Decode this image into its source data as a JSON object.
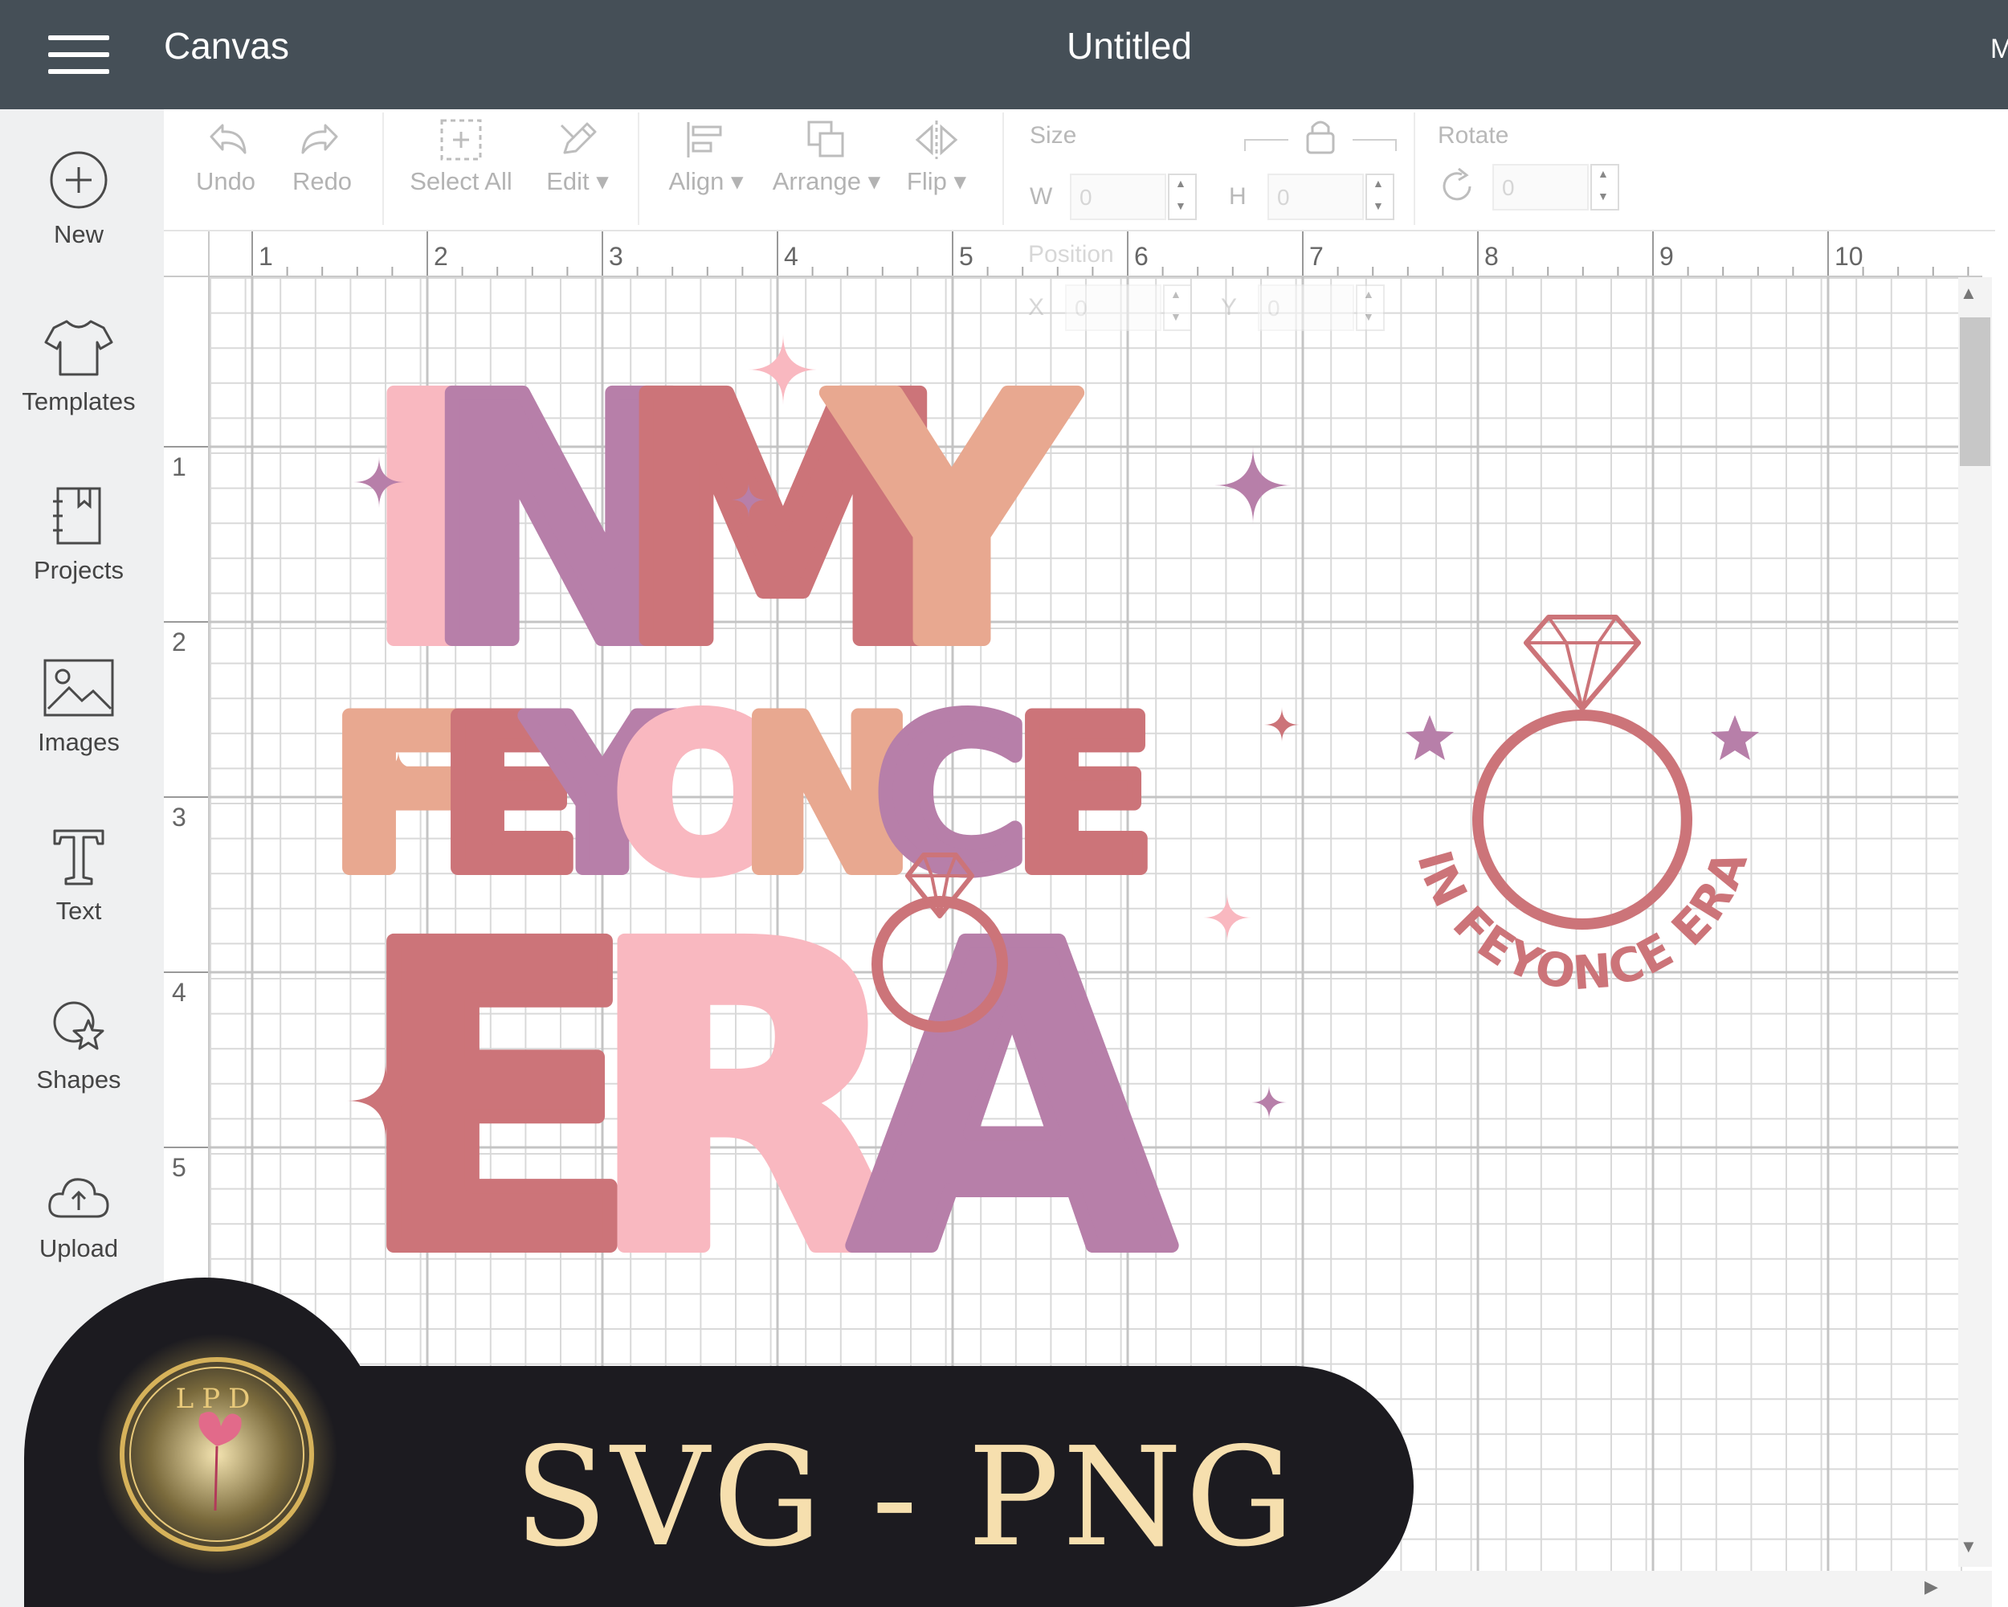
{
  "header": {
    "app_title": "Canvas",
    "document_title": "Untitled",
    "right_truncated": "M"
  },
  "sidebar": {
    "items": [
      {
        "label": "New",
        "icon": "plus-circle-icon"
      },
      {
        "label": "Templates",
        "icon": "tshirt-icon"
      },
      {
        "label": "Projects",
        "icon": "notebook-icon"
      },
      {
        "label": "Images",
        "icon": "image-icon"
      },
      {
        "label": "Text",
        "icon": "text-t-icon"
      },
      {
        "label": "Shapes",
        "icon": "shapes-icon"
      },
      {
        "label": "Upload",
        "icon": "cloud-upload-icon"
      }
    ]
  },
  "toolbar": {
    "undo": "Undo",
    "redo": "Redo",
    "select_all": "Select All",
    "edit": "Edit",
    "align": "Align",
    "arrange": "Arrange",
    "flip": "Flip",
    "size_label": "Size",
    "w_label": "W",
    "w_value": "0",
    "h_label": "H",
    "h_value": "0",
    "rotate_label": "Rotate",
    "rotate_value": "0",
    "position_label": "Position",
    "x_label": "X",
    "x_value": "0",
    "y_label": "Y",
    "y_value": "0"
  },
  "ruler": {
    "top": [
      "1",
      "2",
      "3",
      "4",
      "5",
      "6",
      "7",
      "8",
      "9",
      "10"
    ],
    "left": [
      "1",
      "2",
      "3",
      "4",
      "5"
    ]
  },
  "design": {
    "line1": [
      "I",
      "N",
      "M",
      "Y"
    ],
    "line2": [
      "F",
      "E",
      "Y",
      "O",
      "N",
      "C",
      "E"
    ],
    "line3": [
      "E",
      "R",
      "A"
    ],
    "colors": {
      "pink": "#f9b8c0",
      "purple": "#b77fa9",
      "rose": "#cc7479",
      "peach": "#e8a890",
      "ring": "#cc7479"
    }
  },
  "round_logo": {
    "text": "IN FEYONCE ERA"
  },
  "badge": {
    "monogram": "LPD",
    "formats": "SVG - PNG"
  }
}
